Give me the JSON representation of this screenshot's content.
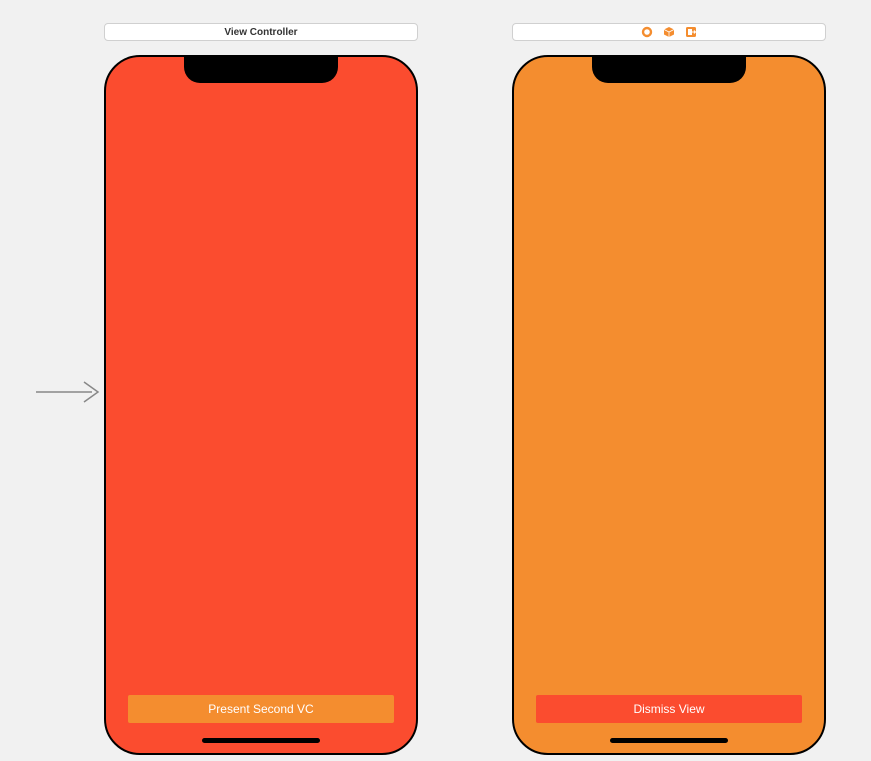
{
  "scenes": {
    "first": {
      "title": "View Controller",
      "button_label": "Present Second VC",
      "background_color": "#fb4c2f",
      "button_color": "#f48d2f"
    },
    "second": {
      "title": "",
      "button_label": "Dismiss View",
      "background_color": "#f48d2f",
      "button_color": "#fb4c2f"
    }
  },
  "icons": {
    "owner": "circle-icon",
    "first_responder": "cube-icon",
    "exit": "exit-icon"
  }
}
